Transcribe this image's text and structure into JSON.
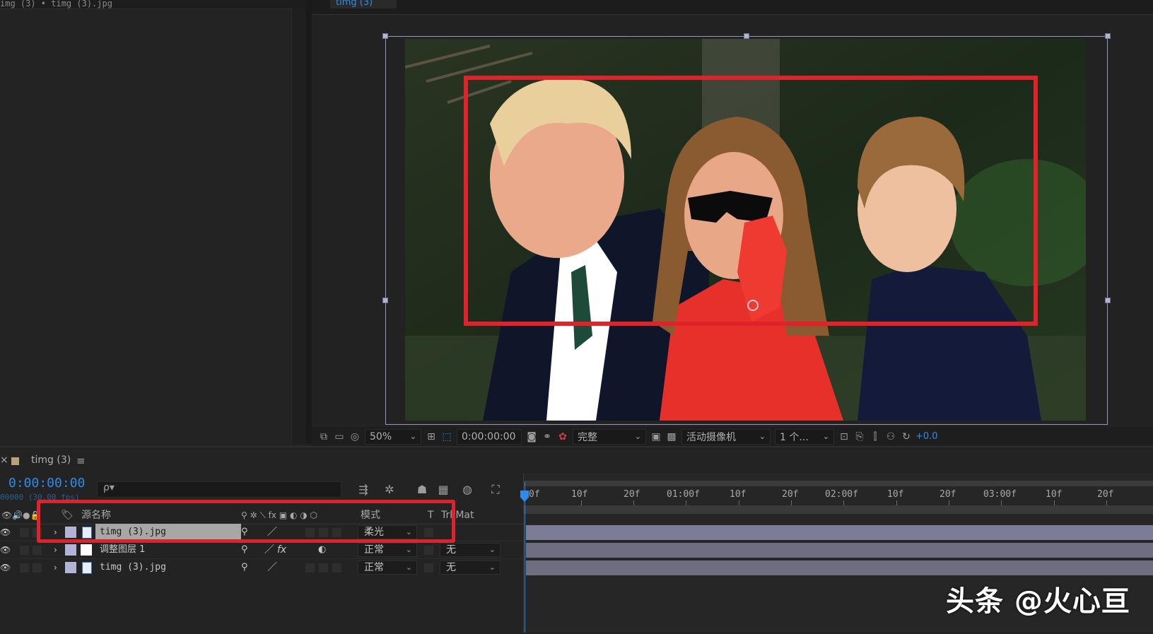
{
  "left_panel": {
    "tab_title": "img (3) • timg (3).jpg"
  },
  "viewer": {
    "tab_title": "timg (3)"
  },
  "viewer_toolbar": {
    "zoom": "50%",
    "timecode": "0:00:00:00",
    "resolution": "完整",
    "camera": "活动摄像机",
    "views": "1 个...",
    "exposure": "+0.0"
  },
  "timeline": {
    "comp_name": "timg (3)",
    "timecode": "0:00:00:00",
    "fps": "00000 (30.00 fps)",
    "search_placeholder": "ρ▾",
    "columns": {
      "source_name": "源名称",
      "mode": "模式",
      "t": "T",
      "trkmat": "TrkMat"
    },
    "layers": [
      {
        "name": "timg (3).jpg",
        "mode": "柔光",
        "trkmat": "",
        "fx": "",
        "selected": true
      },
      {
        "name": "调整图层 1",
        "mode": "正常",
        "trkmat": "无",
        "fx": "fx",
        "selected": false
      },
      {
        "name": "timg (3).jpg",
        "mode": "正常",
        "trkmat": "无",
        "fx": "",
        "selected": false
      }
    ],
    "ruler_labels": [
      "0f",
      "10f",
      "20f",
      "01:00f",
      "10f",
      "20f",
      "02:00f",
      "10f",
      "20f",
      "03:00f",
      "10f",
      "20f"
    ]
  },
  "watermark": "头条 @火心亘",
  "colors": {
    "accent": "#2d8ceb",
    "highlight": "#e0222b",
    "label": "#b3b3d6"
  }
}
